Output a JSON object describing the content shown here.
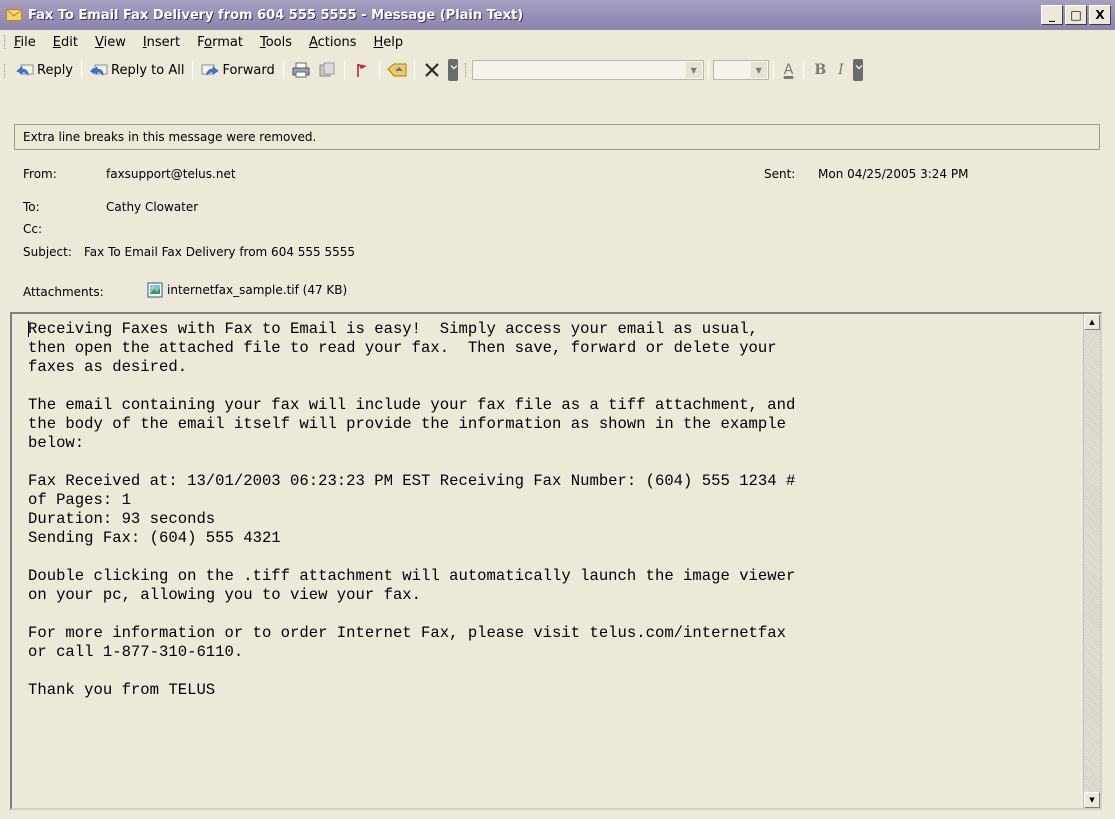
{
  "window": {
    "title": "Fax To Email Fax Delivery from 604 555 5555 - Message (Plain Text)",
    "controls": {
      "minimize": "_",
      "maximize": "□",
      "close": "X"
    }
  },
  "menu": [
    "File",
    "Edit",
    "View",
    "Insert",
    "Format",
    "Tools",
    "Actions",
    "Help"
  ],
  "menu_mnemonics": [
    "F",
    "E",
    "V",
    "I",
    "o",
    "T",
    "A",
    "H"
  ],
  "toolbar": {
    "reply": "Reply",
    "reply_all": "Reply to All",
    "forward": "Forward",
    "font_name": "",
    "font_size": ""
  },
  "infobar": {
    "text": "Extra line breaks in this message were removed."
  },
  "header": {
    "from_label": "From:",
    "from_value": "faxsupport@telus.net",
    "sent_label": "Sent:",
    "sent_value": "Mon 04/25/2005 3:24 PM",
    "to_label": "To:",
    "to_value": "Cathy Clowater",
    "cc_label": "Cc:",
    "cc_value": "",
    "subject_label": "Subject:",
    "subject_value": "Fax To Email Fax Delivery from 604 555 5555",
    "attachments_label": "Attachments:",
    "attachment_name": "internetfax_sample.tif (47 KB)"
  },
  "body": {
    "text": "Receiving Faxes with Fax to Email is easy!  Simply access your email as usual,\nthen open the attached file to read your fax.  Then save, forward or delete your\nfaxes as desired.\n\nThe email containing your fax will include your fax file as a tiff attachment, and\nthe body of the email itself will provide the information as shown in the example\nbelow:\n\nFax Received at: 13/01/2003 06:23:23 PM EST Receiving Fax Number: (604) 555 1234 #\nof Pages: 1\nDuration: 93 seconds\nSending Fax: (604) 555 4321\n\nDouble clicking on the .tiff attachment will automatically launch the image viewer\non your pc, allowing you to view your fax.\n\nFor more information or to order Internet Fax, please visit telus.com/internetfax\nor call 1-877-310-6110.\n\nThank you from TELUS"
  },
  "colors": {
    "titlebar": "#9a91b8",
    "chrome": "#ece9d8",
    "toolbar_chevron": "#6b6b6b"
  }
}
